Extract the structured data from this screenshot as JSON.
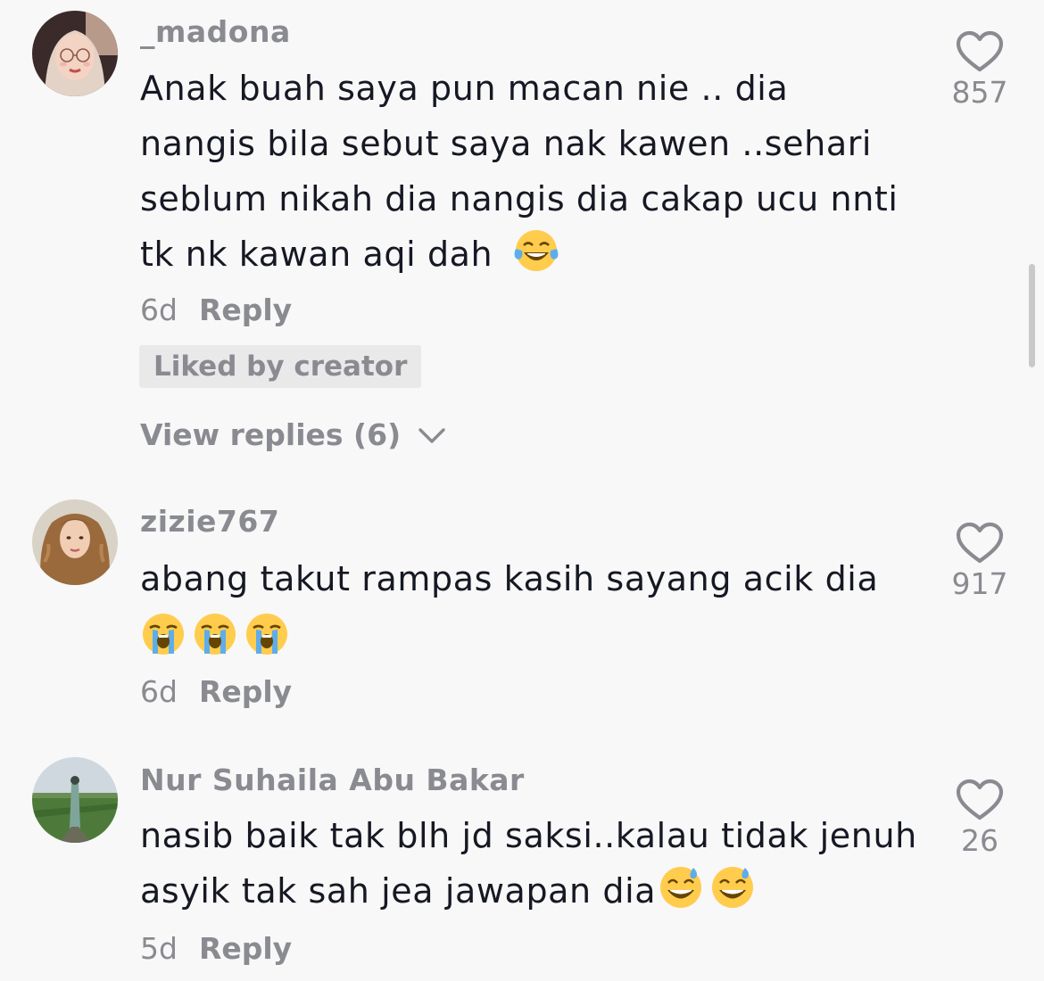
{
  "comments": [
    {
      "username": "_madona",
      "lines": [
        "Anak buah saya pun macan nie .. dia",
        "nangis bila sebut saya nak kawen ..sehari",
        "seblum nikah dia nangis dia cakap ucu nnti",
        "tk nk kawan aqi dah"
      ],
      "emoji": "face-with-tears-of-joy",
      "date": "6d",
      "reply_label": "Reply",
      "liked_badge": "Liked by creator",
      "view_replies": "View replies (6)",
      "likes": "857"
    },
    {
      "username": "zizie767",
      "lines": [
        "abang takut rampas kasih sayang acik dia"
      ],
      "emoji": "loudly-crying-face",
      "date": "6d",
      "reply_label": "Reply",
      "likes": "917"
    },
    {
      "username": "Nur Suhaila Abu Bakar",
      "lines": [
        "nasib baik tak blh jd saksi..kalau tidak jenuh",
        "asyik tak sah jea jawapan dia"
      ],
      "emoji": "grinning-face-with-sweat",
      "date": "5d",
      "reply_label": "Reply",
      "likes": "26"
    }
  ],
  "colors": {
    "background": "#f8f8f8",
    "text": "#161823",
    "secondary": "#8a8b91",
    "badge_bg": "#e9e9ea"
  },
  "icons": [
    "heart-outline-icon",
    "chevron-down-icon"
  ]
}
